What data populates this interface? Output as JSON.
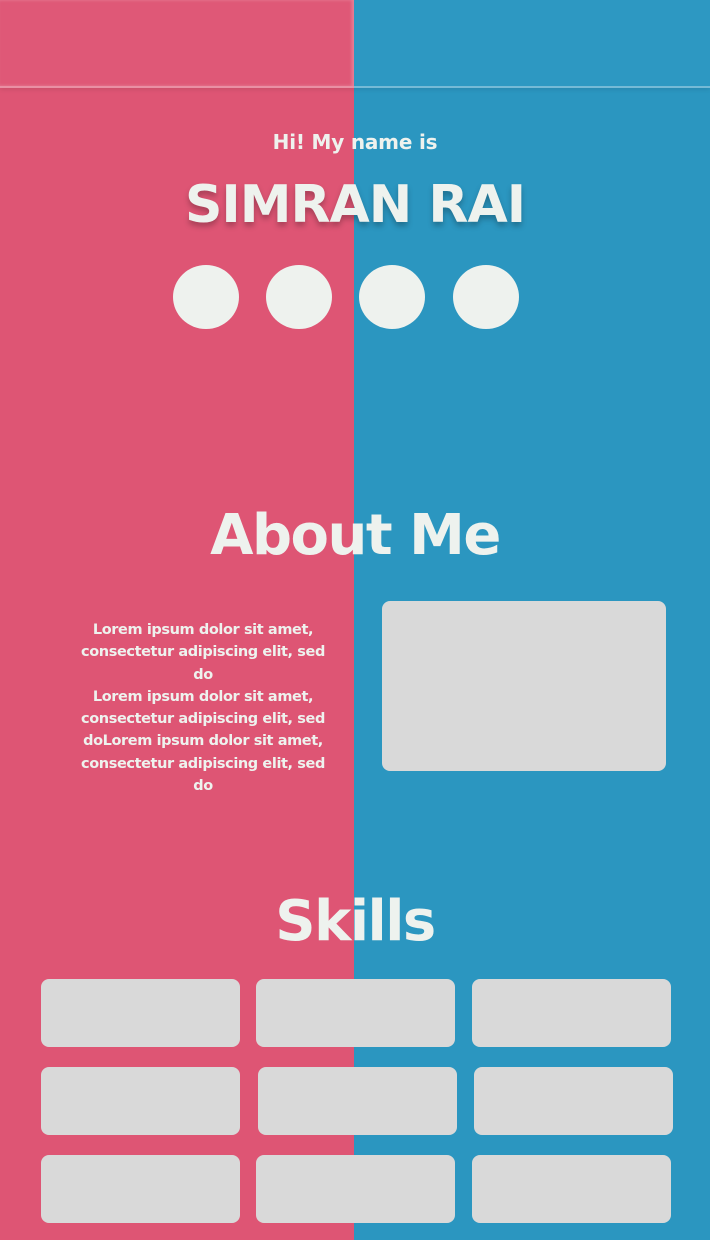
{
  "colors": {
    "left_panel": "#de5574",
    "right_panel": "#2b96c0",
    "text": "#eef2ee",
    "placeholder": "#d9d9d9"
  },
  "hero": {
    "intro": "Hi! My name is",
    "name": "SIMRAN RAI",
    "social_buttons": [
      {
        "icon": "social-icon-1"
      },
      {
        "icon": "social-icon-2"
      },
      {
        "icon": "social-icon-3"
      },
      {
        "icon": "social-icon-4"
      }
    ]
  },
  "about": {
    "title": "About Me",
    "lines": [
      "Lorem ipsum dolor sit amet,",
      "consectetur adipiscing elit, sed do",
      "Lorem ipsum dolor sit amet,",
      "consectetur adipiscing elit, sed",
      "doLorem ipsum dolor sit amet,",
      "consectetur adipiscing elit, sed do"
    ]
  },
  "skills": {
    "title": "Skills",
    "card_count": 9
  }
}
